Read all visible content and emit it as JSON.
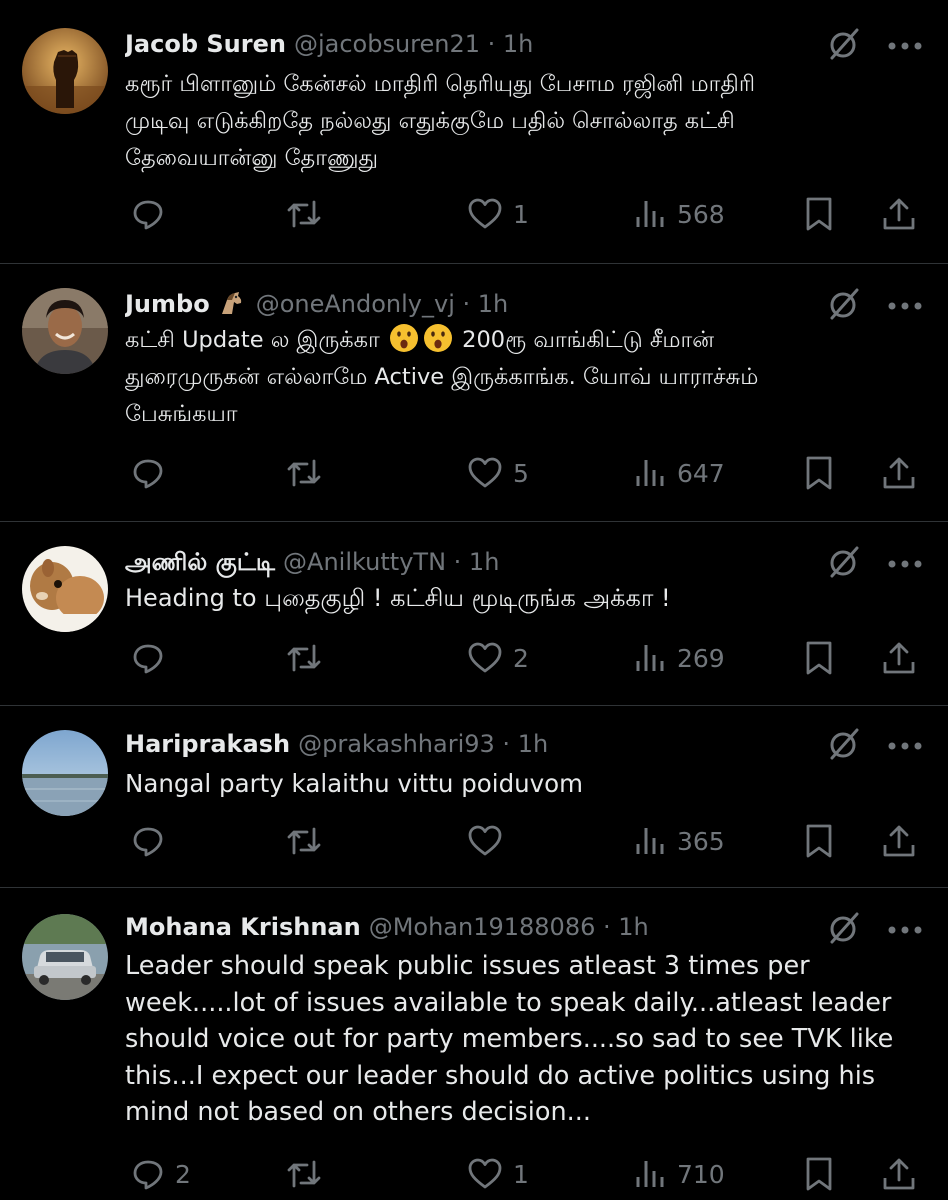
{
  "replies": [
    {
      "name": "Jacob Suren",
      "handle": "@jacobsuren21",
      "sep": " · ",
      "time": "1h",
      "text": "கரூர் பிளானும் கேன்சல் மாதிரி தெரியுது பேசாம ரஜினி மாதிரி\nமுடிவு எடுக்கிறதே நல்லது எதுக்குமே பதில் சொல்லாத கட்சி\nதேவையான்னு தோணுது",
      "reply_count": "",
      "retweet_count": "",
      "like_count": "1",
      "view_count": "568",
      "avatar": "raised-fist"
    },
    {
      "name": "Jumbo",
      "handle": "@oneAndonly_vj",
      "sep": " · ",
      "time": "1h",
      "text_a": "கட்சி Update ல இருக்கா",
      "text_b": " 200ரூ வாங்கிட்டு சீமான்\nதுரைமுருகன் எல்லாமே Active இருக்காங்க.  யோவ் யாராச்சும்\nபேசுங்கயா",
      "reply_count": "",
      "retweet_count": "",
      "like_count": "5",
      "view_count": "647",
      "avatar": "man-portrait"
    },
    {
      "name": "அணில் குட்டி",
      "handle": "@AnilkuttyTN",
      "sep": " · ",
      "time": "1h",
      "text": "Heading to புதைகுழி ! கட்சிய மூடிருங்க அக்கா !",
      "reply_count": "",
      "retweet_count": "",
      "like_count": "2",
      "view_count": "269",
      "avatar": "squirrel"
    },
    {
      "name": "Hariprakash",
      "handle": "@prakashhari93",
      "sep": " · ",
      "time": "1h",
      "text": "Nangal party kalaithu vittu poiduvom",
      "reply_count": "",
      "retweet_count": "",
      "like_count": "",
      "view_count": "365",
      "avatar": "lake"
    },
    {
      "name": "Mohana Krishnan",
      "handle": "@Mohan19188086",
      "sep": " · ",
      "time": "1h",
      "text": "Leader should speak public issues atleast 3 times per\nweek.....lot of issues available to speak daily...atleast leader\nshould voice out for party members....so sad to see TVK like\nthis...I expect our leader should do active politics using his\nmind not based on others decision...",
      "reply_count": "2",
      "retweet_count": "",
      "like_count": "1",
      "view_count": "710",
      "avatar": "car"
    }
  ],
  "icons": {
    "reply": "reply-icon",
    "retweet": "retweet-icon",
    "like": "heart-icon",
    "views": "views-icon",
    "bookmark": "bookmark-icon",
    "share": "share-icon",
    "grok": "grok-icon",
    "more": "more-icon"
  },
  "colors": {
    "background": "#000000",
    "text": "#e7e9ea",
    "muted": "#71767b",
    "divider": "#2f3336"
  }
}
